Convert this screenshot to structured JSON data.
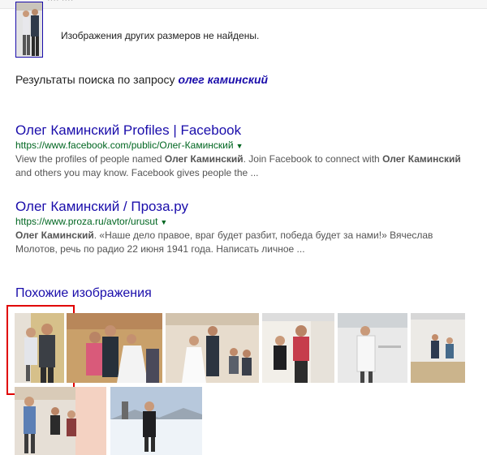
{
  "top": {
    "cut_text": "···· ····",
    "no_other_sizes": "Изображения других размеров не найдены."
  },
  "search": {
    "prefix": "Результаты поиска по запросу",
    "query": "олег каминский"
  },
  "results": [
    {
      "title": "Олег Каминский Profiles | Facebook",
      "url": "https://www.facebook.com/public/Олег-Каминский",
      "snippet_parts": [
        "View the profiles of people named ",
        "Олег Каминский",
        ". Join Facebook to connect with ",
        "Олег Каминский",
        " and others you may know. Facebook gives people the ..."
      ]
    },
    {
      "title": "Олег Каминский / Проза.ру",
      "url": "https://www.proza.ru/avtor/urusut",
      "snippet_parts": [
        "Олег Каминский",
        ". «Наше дело правое, враг будет разбит, победа будет за нами!» Вячеслав Молотов, речь по радио 22 июня 1941 года. Написать личное ..."
      ]
    }
  ],
  "similar": {
    "heading": "Похожие изображения"
  },
  "colors": {
    "link": "#1a0dab",
    "url": "#006621",
    "snippet": "#545454",
    "highlight": "#e00000"
  }
}
